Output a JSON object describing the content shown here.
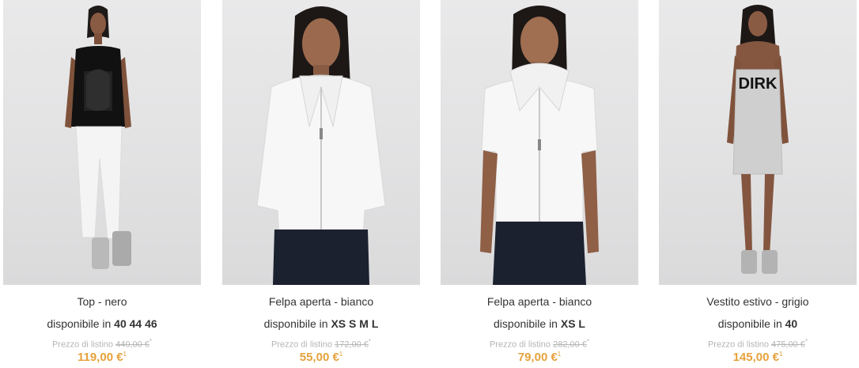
{
  "products": [
    {
      "title": "Top - nero",
      "availability_prefix": "disponibile in",
      "sizes": "40 44 46",
      "list_price_label": "Prezzo di listino",
      "list_price": "440,00 €",
      "list_price_mark": "*",
      "price": "119,00 €",
      "price_mark": "1",
      "image": "model in black sleeveless top and white pants"
    },
    {
      "title": "Felpa aperta - bianco",
      "availability_prefix": "disponibile in",
      "sizes": "XS S M L",
      "list_price_label": "Prezzo di listino",
      "list_price": "172,00 €",
      "list_price_mark": "*",
      "price": "55,00 €",
      "price_mark": "1",
      "image": "model in white zip sweatshirt and dark jeans"
    },
    {
      "title": "Felpa aperta - bianco",
      "availability_prefix": "disponibile in",
      "sizes": "XS L",
      "list_price_label": "Prezzo di listino",
      "list_price": "282,00 €",
      "list_price_mark": "*",
      "price": "79,00 €",
      "price_mark": "1",
      "image": "model in white short-sleeve hoodie and dark jeans"
    },
    {
      "title": "Vestito estivo - grigio",
      "availability_prefix": "disponibile in",
      "sizes": "40",
      "list_price_label": "Prezzo di listino",
      "list_price": "475,00 €",
      "list_price_mark": "*",
      "price": "145,00 €",
      "price_mark": "1",
      "image": "model in grey strapless dress with DIRK print",
      "print_text": "DIRK"
    }
  ],
  "colors": {
    "price": "#e6a23c",
    "list_price": "#b5b5b5",
    "text": "#333333"
  }
}
